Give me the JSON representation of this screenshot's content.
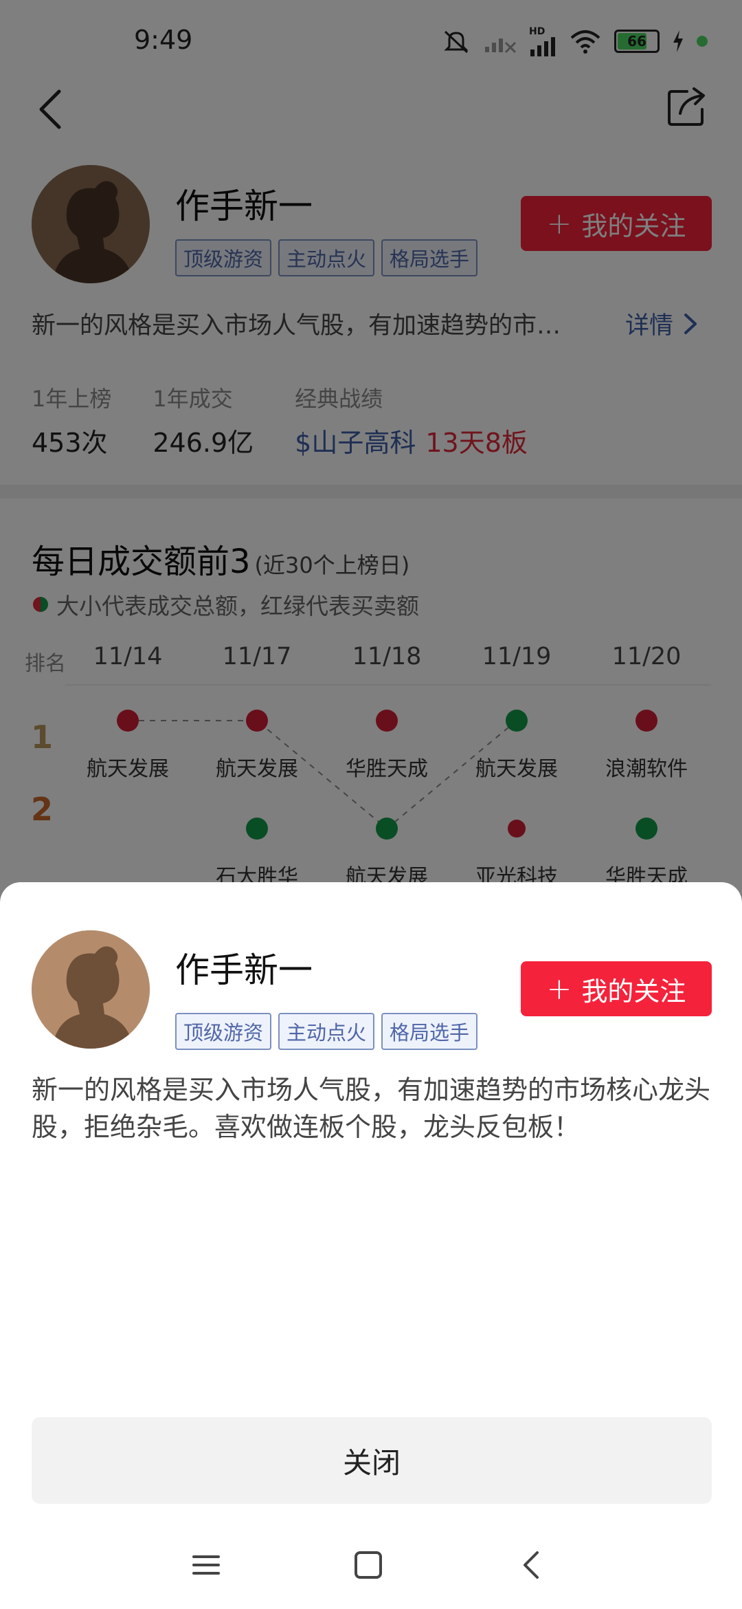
{
  "status_bar": {
    "time": "9:49",
    "battery": "66",
    "network": "HD"
  },
  "profile": {
    "name": "作手新一",
    "tags": [
      "顶级游资",
      "主动点火",
      "格局选手"
    ],
    "follow_plus": "+",
    "follow_label": "我的关注",
    "description_short": "新一的风格是买入市场人气股，有加速趋势的市…",
    "detail_link": "详情",
    "stats": [
      {
        "label": "1年上榜",
        "value": "453次"
      },
      {
        "label": "1年成交",
        "value": "246.9亿"
      },
      {
        "label": "经典战绩",
        "value_stock": "$山子高科",
        "value_record": "13天8板"
      }
    ]
  },
  "daily_top": {
    "title": "每日成交额前3",
    "subtitle": "(近30个上榜日)",
    "legend": "大小代表成交总额，红绿代表买卖额",
    "rank_header": "排名",
    "dates": [
      "11/14",
      "11/17",
      "11/18",
      "11/19",
      "11/20"
    ],
    "ranks": [
      "1",
      "2"
    ],
    "rows": [
      [
        "航天发展",
        "航天发展",
        "华胜天成",
        "航天发展",
        "浪潮软件"
      ],
      [
        "",
        "石大胜华",
        "航天发展",
        "亚光科技",
        "华胜天成"
      ]
    ],
    "colors": {
      "buy": "#d11f36",
      "sell": "#129a4a"
    }
  },
  "sheet": {
    "name": "作手新一",
    "tags": [
      "顶级游资",
      "主动点火",
      "格局选手"
    ],
    "follow_plus": "+",
    "follow_label": "我的关注",
    "description": "新一的风格是买入市场人气股，有加速趋势的市场核心龙头股，拒绝杂毛。喜欢做连板个股，龙头反包板！",
    "close_label": "关闭"
  },
  "colors": {
    "accent": "#f5223b",
    "link": "#3d5ea8"
  }
}
